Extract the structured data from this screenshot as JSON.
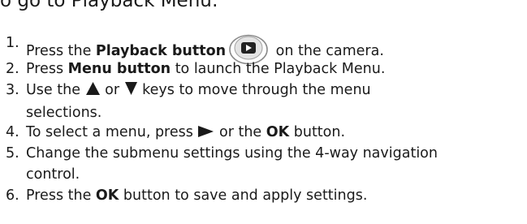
{
  "heading": "o go to Playback Menu:",
  "steps": [
    {
      "number": "1.",
      "pre": "Press the ",
      "bold": "Playback button",
      "icon": "playback-button-icon",
      "post": " on the camera."
    },
    {
      "number": "2.",
      "pre": "Press ",
      "bold": "Menu button",
      "post": " to launch the Playback Menu."
    },
    {
      "number": "3.",
      "pre": "Use the ",
      "icon_a": "up-arrow-icon",
      "mid": " or ",
      "icon_b": "down-arrow-icon",
      "post": " keys to move through the menu",
      "cont": "selections."
    },
    {
      "number": "4.",
      "pre": "To select a menu, press ",
      "icon": "right-arrow-icon",
      "mid": " or the ",
      "bold": "OK",
      "post": " button."
    },
    {
      "number": "5.",
      "pre": "Change the submenu settings using the 4-way navigation",
      "cont": "control."
    },
    {
      "number": "6.",
      "pre": "Press the ",
      "bold": "OK",
      "post": " button to save and apply settings."
    }
  ]
}
